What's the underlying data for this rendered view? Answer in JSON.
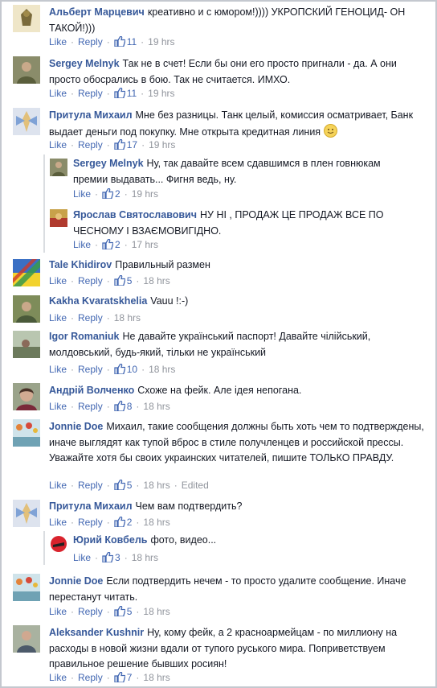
{
  "labels": {
    "like": "Like",
    "reply": "Reply",
    "edited": "Edited"
  },
  "comments": [
    {
      "name": "Альберт Марцевич",
      "text": "креативно и с юмором!)))) УКРОПСКИЙ ГЕНОЦИД- ОН ТАКОЙ!)))",
      "likes": "11",
      "time": "19 hrs"
    },
    {
      "name": "Sergey Melnyk",
      "text": "Так не в счет! Если бы они его просто пригнали - да. А они просто обосрались в бою. Так не считается. ИМХО.",
      "likes": "11",
      "time": "19 hrs"
    },
    {
      "name": "Притула Михаил",
      "text": "Мне без разницы. Танк целый, комиссия осматривает, Банк выдает деньги под покупку. Мне открыта кредитная линия",
      "likes": "17",
      "time": "19 hrs"
    },
    {
      "name": "Sergey Melnyk",
      "text": "Ну, так давайте всем сдавшимся в плен говнюкам премии выдавать... Фигня ведь, ну.",
      "likes": "2",
      "time": "19 hrs"
    },
    {
      "name": "Ярослав Святославович",
      "text": "НУ НІ , ПРОДАЖ ЦЕ ПРОДАЖ ВСЕ ПО ЧЕСНОМУ І ВЗАЄМОВИГІДНО.",
      "likes": "2",
      "time": "17 hrs"
    },
    {
      "name": "Tale Khidirov",
      "text": "Правильный размен",
      "likes": "5",
      "time": "18 hrs"
    },
    {
      "name": "Kakha Kvaratskhelia",
      "text": "Vauu !:-)",
      "likes": "",
      "time": "18 hrs"
    },
    {
      "name": "Igor Romaniuk",
      "text": "Не давайте український паспорт! Давайте чілійський, молдовський, будь-який, тільки не український",
      "likes": "10",
      "time": "18 hrs"
    },
    {
      "name": "Андрій Волченко",
      "text": "Схоже на фейк. Але ідея непогана.",
      "likes": "8",
      "time": "18 hrs"
    },
    {
      "name": "Jonnie Doe",
      "text": "Михаил, такие сообщения должны быть хоть чем то подтверждены, иначе выглядят как тупой вброс в стиле получленцев и российской прессы. Уважайте хотя бы своих украинских читателей, пишите ТОЛЬКО ПРАВДУ.",
      "likes": "5",
      "time": "18 hrs"
    },
    {
      "name": "Притула Михаил",
      "text": "Чем вам подтвердить?",
      "likes": "2",
      "time": "18 hrs"
    },
    {
      "name": "Юрий Ковбель",
      "text": "фото, видео...",
      "likes": "3",
      "time": "18 hrs"
    },
    {
      "name": "Jonnie Doe",
      "text": "Если подтвердить нечем - то просто удалите сообщение. Иначе перестанут читать.",
      "likes": "5",
      "time": "18 hrs"
    },
    {
      "name": "Aleksander Kushnir",
      "text": "Ну, кому фейк, а 2 красноармейцам - по миллиону на расходы в новой жизни вдали от тупого руського мира. Поприветствуем правильное решение бывших росиян!",
      "likes": "7",
      "time": "18 hrs"
    }
  ]
}
